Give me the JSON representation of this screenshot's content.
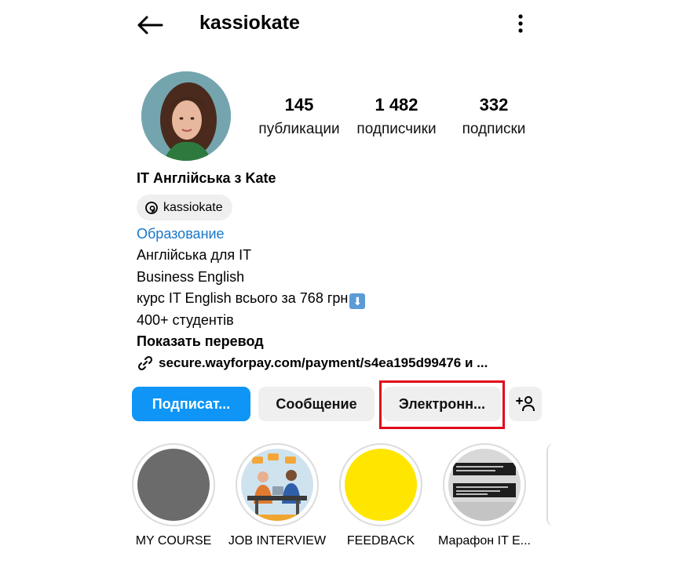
{
  "header": {
    "username": "kassiokate",
    "back_icon": "arrow-left-icon",
    "more_icon": "more-vertical-icon"
  },
  "stats": [
    {
      "value": "145",
      "label": "публикации"
    },
    {
      "value": "1 482",
      "label": "подписчики"
    },
    {
      "value": "332",
      "label": "подписки"
    }
  ],
  "profile": {
    "display_name": "IT Англійська з Kate",
    "threads_handle": "kassiokate",
    "category": "Образование",
    "bio_lines": [
      "Англійська для IT",
      "Business English",
      "курс IT English всього за 768 грн",
      "400+ студентів"
    ],
    "bio_emoji": "⬇",
    "translate_label": "Показать перевод",
    "link": "secure.wayforpay.com/payment/s4ea195d99476 и ..."
  },
  "actions": {
    "follow": "Подписат...",
    "message": "Сообщение",
    "email": "Электронн...",
    "add_person_icon": "add-person-icon"
  },
  "highlights": [
    {
      "label": "MY COURSE",
      "color": "#6b6b6b"
    },
    {
      "label": "JOB INTERVIEW",
      "color": "#2f6ea8"
    },
    {
      "label": "FEEDBACK",
      "color": "#ffe600"
    },
    {
      "label": "Марафон IT E...",
      "color": "#d9d9d9"
    }
  ],
  "colors": {
    "accent_blue": "#0e95f6",
    "link_blue": "#1877c9",
    "highlight_red": "#e0091a",
    "button_gray": "#efefef"
  }
}
